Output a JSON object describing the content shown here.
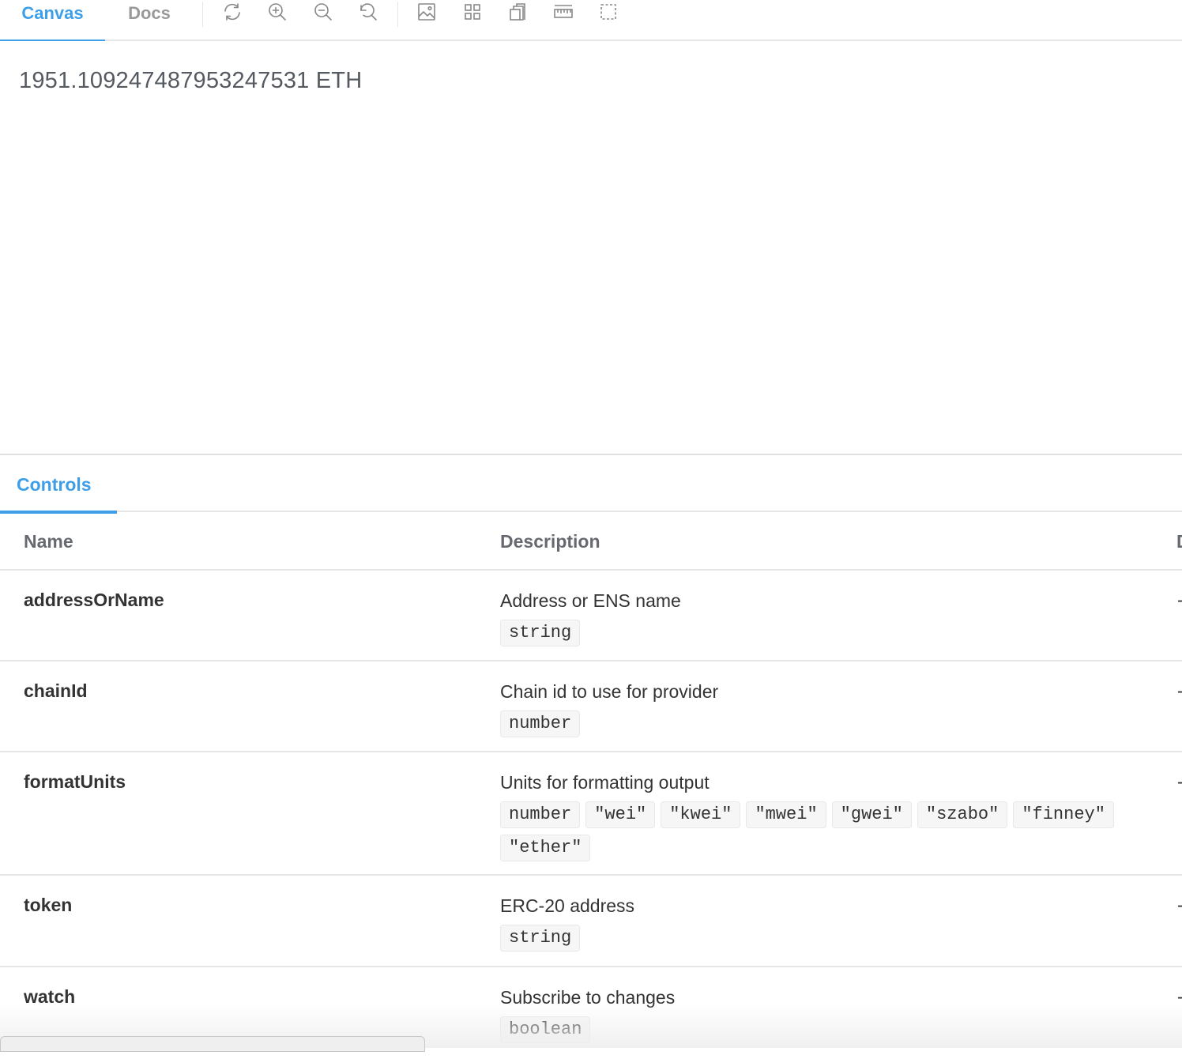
{
  "toolbar": {
    "tabs": [
      {
        "label": "Canvas",
        "active": true
      },
      {
        "label": "Docs",
        "active": false
      }
    ],
    "tools": [
      "reload-icon",
      "zoom-in-icon",
      "zoom-out-icon",
      "reset-zoom-icon",
      "background-image-icon",
      "grid-icon",
      "viewport-icon",
      "measure-icon",
      "outline-icon"
    ]
  },
  "canvas": {
    "balance": "1951.109247487953247531 ETH"
  },
  "panel": {
    "tab": "Controls",
    "columns": {
      "name": "Name",
      "description": "Description"
    },
    "rows": [
      {
        "name": "addressOrName",
        "description": "Address or ENS name",
        "types": [
          "string"
        ],
        "default": "-"
      },
      {
        "name": "chainId",
        "description": "Chain id to use for provider",
        "types": [
          "number"
        ],
        "default": "-"
      },
      {
        "name": "formatUnits",
        "description": "Units for formatting output",
        "types": [
          "number",
          "\"wei\"",
          "\"kwei\"",
          "\"mwei\"",
          "\"gwei\"",
          "\"szabo\"",
          "\"finney\"",
          "\"ether\""
        ],
        "default": "-"
      },
      {
        "name": "token",
        "description": "ERC-20 address",
        "types": [
          "string"
        ],
        "default": "-"
      },
      {
        "name": "watch",
        "description": "Subscribe to changes",
        "types": [
          "boolean"
        ],
        "default": "-"
      }
    ]
  },
  "colors": {
    "accent": "#3e9fe8",
    "border": "#e6e6e6",
    "text": "#333333",
    "muted": "#999999"
  }
}
